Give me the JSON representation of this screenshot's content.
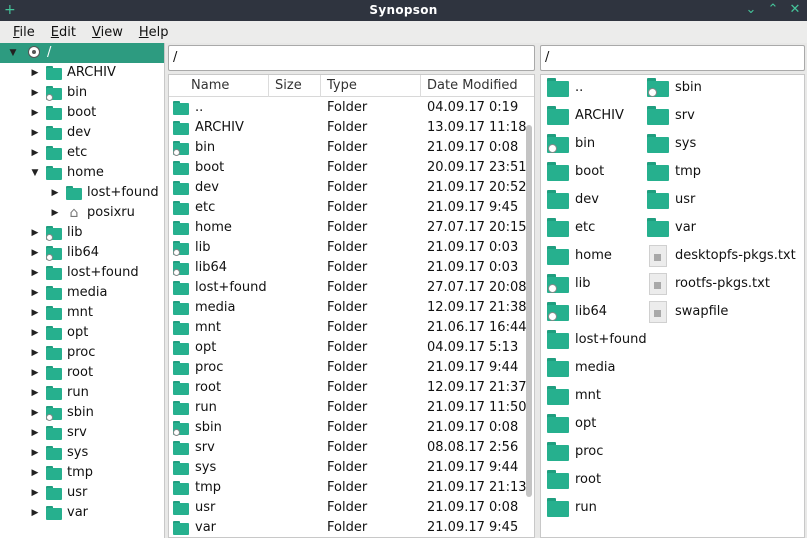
{
  "window": {
    "title": "Synopson",
    "left_icon": "+",
    "controls": [
      "⌄",
      "⌃",
      "✕"
    ]
  },
  "menu": [
    {
      "label": "File",
      "accel": "F",
      "rest": "ile"
    },
    {
      "label": "Edit",
      "accel": "E",
      "rest": "dit"
    },
    {
      "label": "View",
      "accel": "V",
      "rest": "iew"
    },
    {
      "label": "Help",
      "accel": "H",
      "rest": "elp"
    }
  ],
  "tree": [
    {
      "label": "/",
      "level": 0,
      "arrow": "down",
      "icon": "root-drive",
      "selected": true
    },
    {
      "label": "ARCHIV",
      "level": 1,
      "arrow": "right",
      "icon": "folder"
    },
    {
      "label": "bin",
      "level": 1,
      "arrow": "right",
      "icon": "folder-link"
    },
    {
      "label": "boot",
      "level": 1,
      "arrow": "right",
      "icon": "folder"
    },
    {
      "label": "dev",
      "level": 1,
      "arrow": "right",
      "icon": "folder"
    },
    {
      "label": "etc",
      "level": 1,
      "arrow": "right",
      "icon": "folder"
    },
    {
      "label": "home",
      "level": 1,
      "arrow": "down",
      "icon": "folder"
    },
    {
      "label": "lost+found",
      "level": 2,
      "arrow": "right",
      "icon": "folder"
    },
    {
      "label": "posixru",
      "level": 2,
      "arrow": "right",
      "icon": "home"
    },
    {
      "label": "lib",
      "level": 1,
      "arrow": "right",
      "icon": "folder-link"
    },
    {
      "label": "lib64",
      "level": 1,
      "arrow": "right",
      "icon": "folder-link"
    },
    {
      "label": "lost+found",
      "level": 1,
      "arrow": "right",
      "icon": "folder"
    },
    {
      "label": "media",
      "level": 1,
      "arrow": "right",
      "icon": "folder"
    },
    {
      "label": "mnt",
      "level": 1,
      "arrow": "right",
      "icon": "folder"
    },
    {
      "label": "opt",
      "level": 1,
      "arrow": "right",
      "icon": "folder"
    },
    {
      "label": "proc",
      "level": 1,
      "arrow": "right",
      "icon": "folder"
    },
    {
      "label": "root",
      "level": 1,
      "arrow": "right",
      "icon": "folder"
    },
    {
      "label": "run",
      "level": 1,
      "arrow": "right",
      "icon": "folder"
    },
    {
      "label": "sbin",
      "level": 1,
      "arrow": "right",
      "icon": "folder-link"
    },
    {
      "label": "srv",
      "level": 1,
      "arrow": "right",
      "icon": "folder"
    },
    {
      "label": "sys",
      "level": 1,
      "arrow": "right",
      "icon": "folder"
    },
    {
      "label": "tmp",
      "level": 1,
      "arrow": "right",
      "icon": "folder"
    },
    {
      "label": "usr",
      "level": 1,
      "arrow": "right",
      "icon": "folder"
    },
    {
      "label": "var",
      "level": 1,
      "arrow": "right",
      "icon": "folder"
    }
  ],
  "middle": {
    "path": "/",
    "columns": [
      "Name",
      "Size",
      "Type",
      "Date Modified"
    ],
    "rows": [
      {
        "name": "..",
        "size": "",
        "type": "Folder",
        "date": "04.09.17 0:19",
        "link": false
      },
      {
        "name": "ARCHIV",
        "size": "",
        "type": "Folder",
        "date": "13.09.17 11:18",
        "link": false
      },
      {
        "name": "bin",
        "size": "",
        "type": "Folder",
        "date": "21.09.17 0:08",
        "link": true
      },
      {
        "name": "boot",
        "size": "",
        "type": "Folder",
        "date": "20.09.17 23:51",
        "link": false
      },
      {
        "name": "dev",
        "size": "",
        "type": "Folder",
        "date": "21.09.17 20:52",
        "link": false
      },
      {
        "name": "etc",
        "size": "",
        "type": "Folder",
        "date": "21.09.17 9:45",
        "link": false
      },
      {
        "name": "home",
        "size": "",
        "type": "Folder",
        "date": "27.07.17 20:15",
        "link": false
      },
      {
        "name": "lib",
        "size": "",
        "type": "Folder",
        "date": "21.09.17 0:03",
        "link": true
      },
      {
        "name": "lib64",
        "size": "",
        "type": "Folder",
        "date": "21.09.17 0:03",
        "link": true
      },
      {
        "name": "lost+found",
        "size": "",
        "type": "Folder",
        "date": "27.07.17 20:08",
        "link": false
      },
      {
        "name": "media",
        "size": "",
        "type": "Folder",
        "date": "12.09.17 21:38",
        "link": false
      },
      {
        "name": "mnt",
        "size": "",
        "type": "Folder",
        "date": "21.06.17 16:44",
        "link": false
      },
      {
        "name": "opt",
        "size": "",
        "type": "Folder",
        "date": "04.09.17 5:13",
        "link": false
      },
      {
        "name": "proc",
        "size": "",
        "type": "Folder",
        "date": "21.09.17 9:44",
        "link": false
      },
      {
        "name": "root",
        "size": "",
        "type": "Folder",
        "date": "12.09.17 21:37",
        "link": false
      },
      {
        "name": "run",
        "size": "",
        "type": "Folder",
        "date": "21.09.17 11:50",
        "link": false
      },
      {
        "name": "sbin",
        "size": "",
        "type": "Folder",
        "date": "21.09.17 0:08",
        "link": true
      },
      {
        "name": "srv",
        "size": "",
        "type": "Folder",
        "date": "08.08.17 2:56",
        "link": false
      },
      {
        "name": "sys",
        "size": "",
        "type": "Folder",
        "date": "21.09.17 9:44",
        "link": false
      },
      {
        "name": "tmp",
        "size": "",
        "type": "Folder",
        "date": "21.09.17 21:13",
        "link": false
      },
      {
        "name": "usr",
        "size": "",
        "type": "Folder",
        "date": "21.09.17 0:08",
        "link": false
      },
      {
        "name": "var",
        "size": "",
        "type": "Folder",
        "date": "21.09.17 9:45",
        "link": false
      }
    ]
  },
  "right": {
    "path": "/",
    "col1": [
      {
        "label": "..",
        "icon": "folder"
      },
      {
        "label": "ARCHIV",
        "icon": "folder"
      },
      {
        "label": "bin",
        "icon": "folder-link"
      },
      {
        "label": "boot",
        "icon": "folder"
      },
      {
        "label": "dev",
        "icon": "folder"
      },
      {
        "label": "etc",
        "icon": "folder"
      },
      {
        "label": "home",
        "icon": "folder"
      },
      {
        "label": "lib",
        "icon": "folder-link"
      },
      {
        "label": "lib64",
        "icon": "folder-link"
      },
      {
        "label": "lost+found",
        "icon": "folder"
      },
      {
        "label": "media",
        "icon": "folder"
      },
      {
        "label": "mnt",
        "icon": "folder"
      },
      {
        "label": "opt",
        "icon": "folder"
      },
      {
        "label": "proc",
        "icon": "folder"
      },
      {
        "label": "root",
        "icon": "folder"
      },
      {
        "label": "run",
        "icon": "folder"
      }
    ],
    "col2": [
      {
        "label": "sbin",
        "icon": "folder-link"
      },
      {
        "label": "srv",
        "icon": "folder"
      },
      {
        "label": "sys",
        "icon": "folder"
      },
      {
        "label": "tmp",
        "icon": "folder"
      },
      {
        "label": "usr",
        "icon": "folder"
      },
      {
        "label": "var",
        "icon": "folder"
      },
      {
        "label": "desktopfs-pkgs.txt",
        "icon": "file"
      },
      {
        "label": "rootfs-pkgs.txt",
        "icon": "file"
      },
      {
        "label": "swapfile",
        "icon": "file"
      }
    ]
  },
  "colors": {
    "accent": "#2d9b80",
    "folder": "#26b08e",
    "titlebar": "#2f343f"
  }
}
